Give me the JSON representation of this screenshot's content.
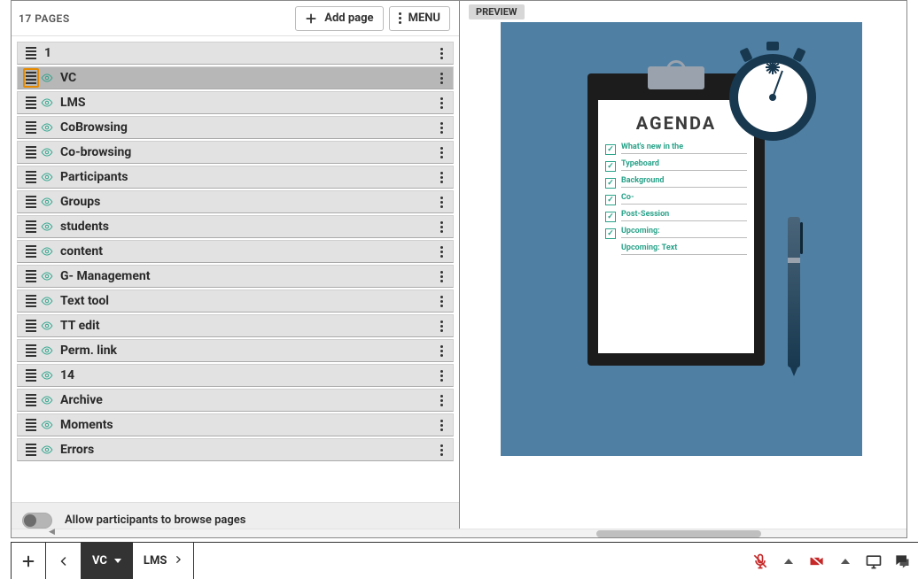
{
  "left": {
    "page_count_label": "17 PAGES",
    "add_page_label": "Add page",
    "menu_label": "MENU",
    "allow_browse_label": "Allow participants to browse pages",
    "allow_browse_state": false
  },
  "pages": [
    {
      "title": "1",
      "visible": false,
      "selected": false,
      "highlighted": false
    },
    {
      "title": "VC",
      "visible": true,
      "selected": true,
      "highlighted": true
    },
    {
      "title": "LMS",
      "visible": true,
      "selected": false,
      "highlighted": false
    },
    {
      "title": "CoBrowsing",
      "visible": true,
      "selected": false,
      "highlighted": false
    },
    {
      "title": "Co-browsing",
      "visible": true,
      "selected": false,
      "highlighted": false
    },
    {
      "title": "Participants",
      "visible": true,
      "selected": false,
      "highlighted": false
    },
    {
      "title": "Groups",
      "visible": true,
      "selected": false,
      "highlighted": false
    },
    {
      "title": "students",
      "visible": true,
      "selected": false,
      "highlighted": false
    },
    {
      "title": "content",
      "visible": true,
      "selected": false,
      "highlighted": false
    },
    {
      "title": "G- Management",
      "visible": true,
      "selected": false,
      "highlighted": false
    },
    {
      "title": "Text tool",
      "visible": true,
      "selected": false,
      "highlighted": false
    },
    {
      "title": "TT edit",
      "visible": true,
      "selected": false,
      "highlighted": false
    },
    {
      "title": "Perm. link",
      "visible": true,
      "selected": false,
      "highlighted": false
    },
    {
      "title": "14",
      "visible": true,
      "selected": false,
      "highlighted": false
    },
    {
      "title": "Archive",
      "visible": true,
      "selected": false,
      "highlighted": false
    },
    {
      "title": "Moments",
      "visible": true,
      "selected": false,
      "highlighted": false
    },
    {
      "title": "Errors",
      "visible": true,
      "selected": false,
      "highlighted": false
    }
  ],
  "preview": {
    "chip_label": "PREVIEW",
    "agenda_title": "AGENDA",
    "agenda_items": [
      {
        "checked": true,
        "text": "What's new in the"
      },
      {
        "checked": true,
        "text": "Typeboard"
      },
      {
        "checked": true,
        "text": "Background"
      },
      {
        "checked": true,
        "text": "Co-"
      },
      {
        "checked": true,
        "text": "Post-Session"
      },
      {
        "checked": true,
        "text": "Upcoming:"
      },
      {
        "checked": false,
        "text": "Upcoming: Text"
      }
    ]
  },
  "bottom": {
    "tabs": [
      {
        "label": "VC",
        "active": true,
        "has_caret": true
      },
      {
        "label": "LMS",
        "active": false,
        "has_caret": false
      }
    ]
  }
}
